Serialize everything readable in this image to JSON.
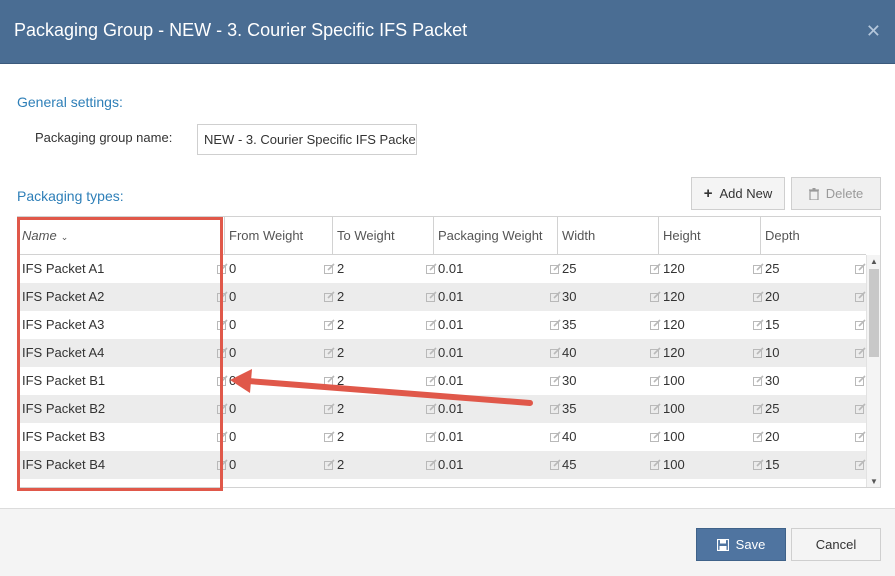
{
  "window": {
    "title": "Packaging Group - NEW - 3. Courier Specific IFS Packet",
    "close_icon": "close-icon"
  },
  "general": {
    "heading": "General settings:",
    "name_label": "Packaging group name:",
    "name_value": "NEW - 3. Courier Specific IFS Packe"
  },
  "packaging": {
    "heading": "Packaging types:",
    "add_new_label": "Add New",
    "add_new_icon": "plus-icon",
    "delete_label": "Delete",
    "delete_icon": "trash-icon",
    "columns": [
      "Name",
      "From Weight",
      "To Weight",
      "Packaging Weight",
      "Width",
      "Height",
      "Depth"
    ],
    "sorted_column": "Name",
    "rows": [
      [
        "IFS Packet A1",
        "0",
        "2",
        "0.01",
        "25",
        "120",
        "25"
      ],
      [
        "IFS Packet A2",
        "0",
        "2",
        "0.01",
        "30",
        "120",
        "20"
      ],
      [
        "IFS Packet A3",
        "0",
        "2",
        "0.01",
        "35",
        "120",
        "15"
      ],
      [
        "IFS Packet A4",
        "0",
        "2",
        "0.01",
        "40",
        "120",
        "10"
      ],
      [
        "IFS Packet B1",
        "0",
        "2",
        "0.01",
        "30",
        "100",
        "30"
      ],
      [
        "IFS Packet B2",
        "0",
        "2",
        "0.01",
        "35",
        "100",
        "25"
      ],
      [
        "IFS Packet B3",
        "0",
        "2",
        "0.01",
        "40",
        "100",
        "20"
      ],
      [
        "IFS Packet B4",
        "0",
        "2",
        "0.01",
        "45",
        "100",
        "15"
      ]
    ]
  },
  "footer": {
    "save_label": "Save",
    "save_icon": "floppy-disk-icon",
    "cancel_label": "Cancel"
  },
  "colors": {
    "titlebar": "#4a6d93",
    "accent_text": "#2e7fb8",
    "primary_button": "#4f74a0",
    "annotation": "#e0584a"
  }
}
